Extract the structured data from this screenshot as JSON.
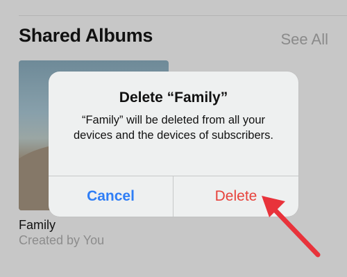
{
  "background": {
    "section_title": "Shared Albums",
    "see_all_label": "See All",
    "album": {
      "name": "Family",
      "subtitle": "Created by You"
    }
  },
  "alert": {
    "title": "Delete “Family”",
    "message": "“Family” will be deleted from all your devices and the devices of subscribers.",
    "cancel_label": "Cancel",
    "delete_label": "Delete"
  },
  "colors": {
    "cancel": "#2f7ef6",
    "delete": "#e7423b",
    "annotation": "#e8333b"
  },
  "icons": {
    "annotation": "arrow-icon"
  }
}
